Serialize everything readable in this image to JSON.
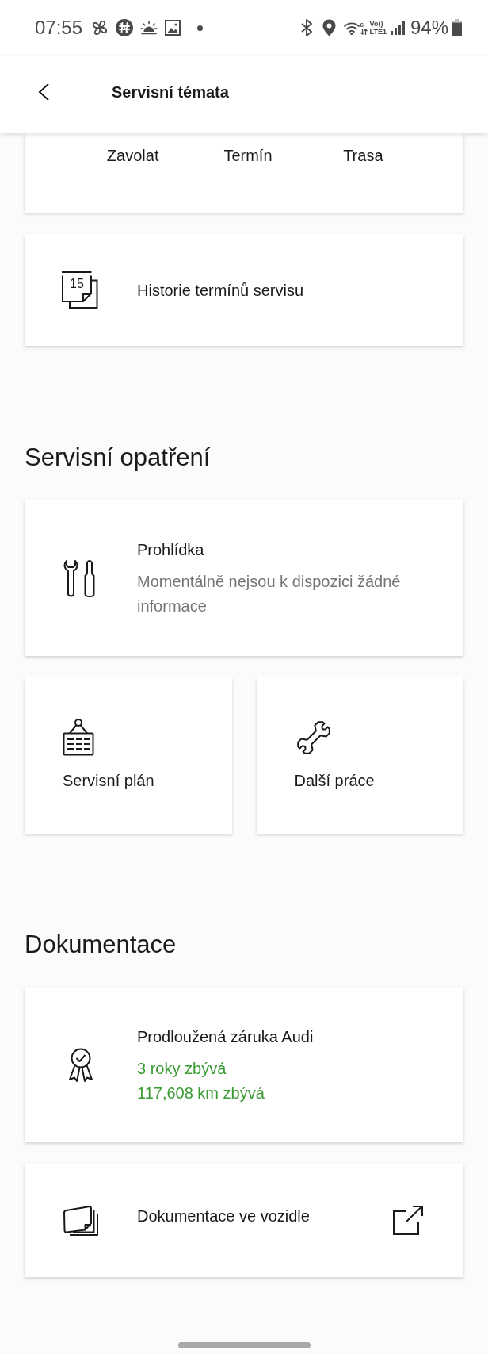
{
  "status_bar": {
    "time": "07:55",
    "wifi_standard": "6",
    "network": [
      "Vo))",
      "LTE1"
    ],
    "battery": "94%"
  },
  "header": {
    "title": "Servisní témata"
  },
  "contact_card": {
    "actions": [
      {
        "label": "Zavolat"
      },
      {
        "label": "Termín"
      },
      {
        "label": "Trasa"
      }
    ]
  },
  "history_card": {
    "icon_day": "15",
    "label": "Historie termínů servisu"
  },
  "service_section": {
    "title": "Servisní opatření",
    "inspection_card": {
      "title": "Prohlídka",
      "message": "Momentálně nejsou k dispozici žádné informace"
    },
    "tiles": [
      {
        "label": "Servisní plán"
      },
      {
        "label": "Další práce"
      }
    ]
  },
  "documentation_section": {
    "title": "Dokumentace",
    "warranty_card": {
      "title": "Prodloužená záruka Audi",
      "remaining": [
        "3 roky zbývá",
        "117,608 km zbývá"
      ]
    },
    "vehicle_docs_card": {
      "label": "Dokumentace ve vozidle"
    }
  }
}
